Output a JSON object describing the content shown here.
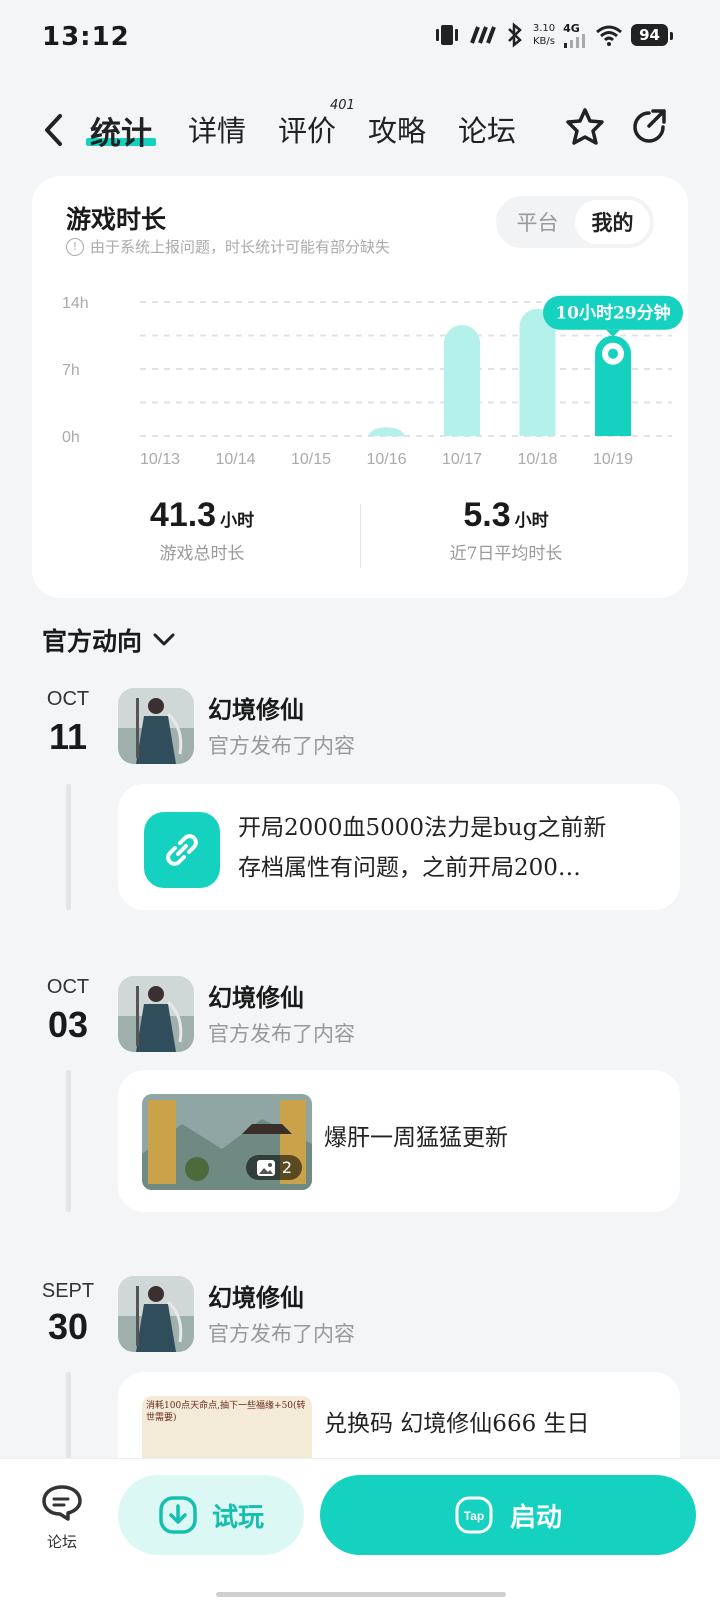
{
  "status_bar": {
    "time": "13:12",
    "net_speed_value": "3.10",
    "net_speed_unit": "KB/s",
    "network": "4G",
    "battery": "94"
  },
  "nav": {
    "tabs": [
      {
        "label": "统计",
        "active": true
      },
      {
        "label": "详情"
      },
      {
        "label": "评价",
        "badge": "401"
      },
      {
        "label": "攻略"
      },
      {
        "label": "论坛"
      }
    ]
  },
  "stats": {
    "title": "游戏时长",
    "note": "由于系统上报问题，时长统计可能有部分缺失",
    "segment": [
      "平台",
      "我的"
    ],
    "segment_active": "我的",
    "total_value": "41.3",
    "total_unit": "小时",
    "total_label": "游戏总时长",
    "avg_value": "5.3",
    "avg_unit": "小时",
    "avg_label": "近7日平均时长"
  },
  "chart_data": {
    "type": "bar",
    "categories": [
      "10/13",
      "10/14",
      "10/15",
      "10/16",
      "10/17",
      "10/18",
      "10/19"
    ],
    "values": [
      0,
      0,
      0,
      0.9,
      11.6,
      13.3,
      10.48
    ],
    "ylim": [
      0,
      14
    ],
    "yticks": [
      "0h",
      "7h",
      "14h"
    ],
    "highlight_index": 6,
    "highlight_label": "10小时29分钟",
    "grid": true,
    "colors": {
      "bar": "#b3f1ea",
      "highlight": "#15d1bf"
    }
  },
  "section": {
    "title": "官方动向"
  },
  "posts": [
    {
      "month": "OCT",
      "day": "11",
      "author": "幻境修仙",
      "sub": "官方发布了内容",
      "text_line1": "开局2000血5000法力是bug之前新",
      "text_line2": "存档属性有问题，之前开局200…"
    },
    {
      "month": "OCT",
      "day": "03",
      "author": "幻境修仙",
      "sub": "官方发布了内容",
      "text": "爆肝一周猛猛更新",
      "image_count": "2"
    },
    {
      "month": "SEPT",
      "day": "30",
      "author": "幻境修仙",
      "sub": "官方发布了内容",
      "text": "兑换码 幻境修仙666 生日",
      "thumb_text": "消耗100点天命点,抽下一些福缘+50(转世需要)"
    }
  ],
  "bottom": {
    "forum_label": "论坛",
    "trial_label": "试玩",
    "launch_label": "启动",
    "tap_logo": "Tap"
  },
  "accent_color": "#15d1bf"
}
